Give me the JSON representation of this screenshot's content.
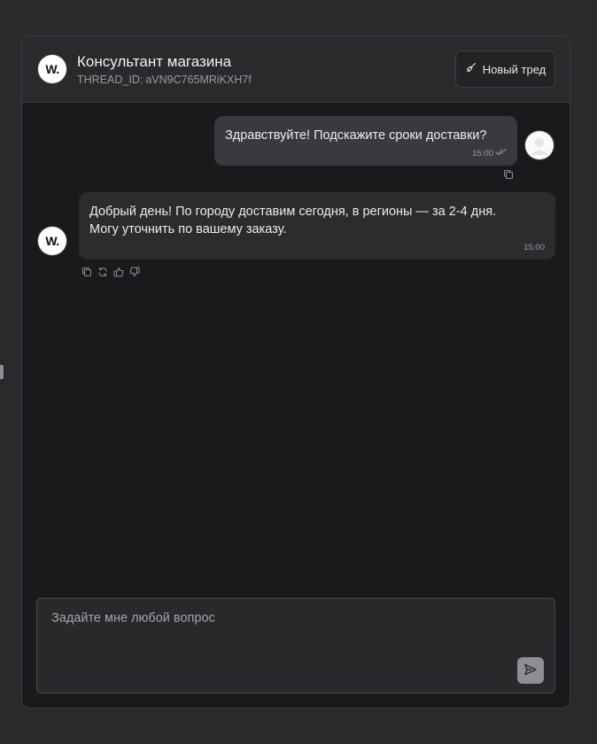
{
  "header": {
    "logo_text": "W.",
    "title": "Консультант магазина",
    "thread_label": "THREAD_ID:",
    "thread_id": "aVN9C765MRiKXH7f",
    "new_thread_label": "Новый тред"
  },
  "messages": [
    {
      "role": "user",
      "text": "Здравствуйте! Подскажите сроки доставки?",
      "time": "15:00",
      "read": true
    },
    {
      "role": "assistant",
      "avatar_text": "W.",
      "lines": [
        "Добрый день! По городу доставим сегодня, в регионы — за 2-4 дня.",
        "Могу уточнить по вашему заказу."
      ],
      "time": "15:00",
      "actions": [
        "copy-icon",
        "regenerate-icon",
        "thumbs-up-icon",
        "thumbs-down-icon"
      ]
    }
  ],
  "composer": {
    "placeholder": "Задайте мне любой вопрос",
    "value": "",
    "send_icon": "send-icon"
  },
  "colors": {
    "page_bg": "#2a2a2d",
    "panel_bg": "#1a1a1c",
    "header_bg": "#2a2a2d",
    "user_bubble": "#3a3a3e",
    "assistant_bubble": "#2c2c2f",
    "send_button": "#8e8e93"
  }
}
